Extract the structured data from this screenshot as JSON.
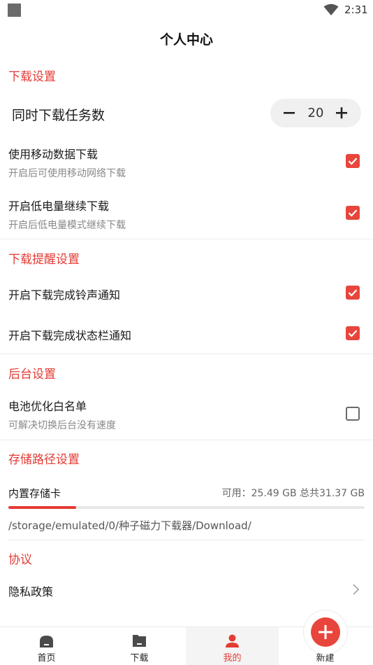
{
  "status_bar": {
    "time": "2:31"
  },
  "page": {
    "title": "个人中心"
  },
  "download_settings": {
    "section_title": "下载设置",
    "concurrent": {
      "label": "同时下载任务数",
      "value": "20"
    },
    "mobile_data": {
      "title": "使用移动数据下载",
      "subtitle": "开启后可使用移动网络下载",
      "checked": true
    },
    "low_battery": {
      "title": "开启低电量继续下载",
      "subtitle": "开启后低电量模式继续下载",
      "checked": true
    }
  },
  "reminder_settings": {
    "section_title": "下载提醒设置",
    "ringtone": {
      "title": "开启下载完成铃声通知",
      "checked": true
    },
    "statusbar": {
      "title": "开启下载完成状态栏通知",
      "checked": true
    }
  },
  "background_settings": {
    "section_title": "后台设置",
    "battery_whitelist": {
      "title": "电池优化白名单",
      "subtitle": "可解决切换后台没有速度",
      "checked": false
    }
  },
  "storage_settings": {
    "section_title": "存储路径设置",
    "label": "内置存储卡",
    "free_text": "可用：25.49 GB 总共31.37 GB",
    "used_fraction": 0.19,
    "path": "/storage/emulated/0/种子磁力下载器/Download/"
  },
  "agreement": {
    "section_title": "协议",
    "privacy": {
      "title": "隐私政策"
    }
  },
  "bottom_nav": {
    "items": [
      {
        "label": "首页",
        "icon": "home-icon"
      },
      {
        "label": "下载",
        "icon": "folder-icon"
      },
      {
        "label": "我的",
        "icon": "user-icon"
      },
      {
        "label": "新建",
        "icon": "plus-icon"
      }
    ],
    "active_index": 2
  },
  "colors": {
    "accent": "#e43b34",
    "checkbox": "#e8453c"
  }
}
